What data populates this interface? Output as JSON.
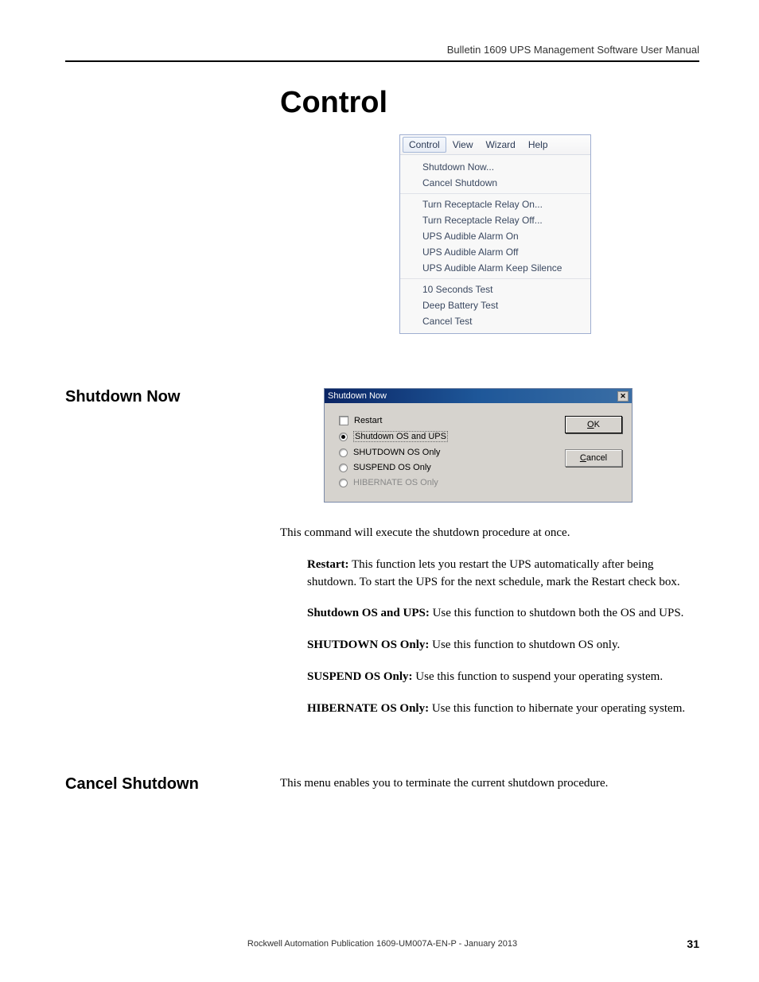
{
  "header": "Bulletin 1609 UPS Management Software User Manual",
  "title": "Control",
  "menubar": {
    "items": [
      "Control",
      "View",
      "Wizard",
      "Help"
    ]
  },
  "menu": {
    "group1": [
      "Shutdown Now...",
      "Cancel Shutdown"
    ],
    "group2": [
      "Turn Receptacle Relay On...",
      "Turn Receptacle Relay Off...",
      "UPS Audible Alarm On",
      "UPS Audible Alarm Off",
      "UPS Audible Alarm Keep Silence"
    ],
    "group3": [
      "10 Seconds Test",
      "Deep Battery Test",
      "Cancel Test"
    ]
  },
  "section1": {
    "heading": "Shutdown Now",
    "dialog_title": "Shutdown Now",
    "options": {
      "restart": "Restart",
      "opt1": "Shutdown OS and UPS",
      "opt2": "SHUTDOWN OS Only",
      "opt3": "SUSPEND OS Only",
      "opt4": "HIBERNATE OS Only"
    },
    "buttons": {
      "ok": "OK",
      "cancel": "Cancel"
    },
    "intro": "This command will execute the shutdown procedure at once.",
    "defs": {
      "restart_label": "Restart:",
      "restart_text": " This function lets you restart the UPS automatically after being shutdown. To start the UPS for the next schedule, mark the Restart check box.",
      "sd_ups_label": "Shutdown OS and UPS:",
      "sd_ups_text": " Use this function to shutdown both the OS and UPS.",
      "sd_os_label": "SHUTDOWN OS Only:",
      "sd_os_text": " Use this function to shutdown OS only.",
      "susp_label": "SUSPEND OS Only:",
      "susp_text": " Use this function to suspend your operating system.",
      "hib_label": "HIBERNATE OS Only:",
      "hib_text": " Use this function to hibernate your operating system."
    }
  },
  "section2": {
    "heading": "Cancel Shutdown",
    "text": "This menu enables you to terminate the current shutdown procedure."
  },
  "footer": {
    "center": "Rockwell Automation Publication 1609-UM007A-EN-P - January 2013",
    "page": "31"
  }
}
